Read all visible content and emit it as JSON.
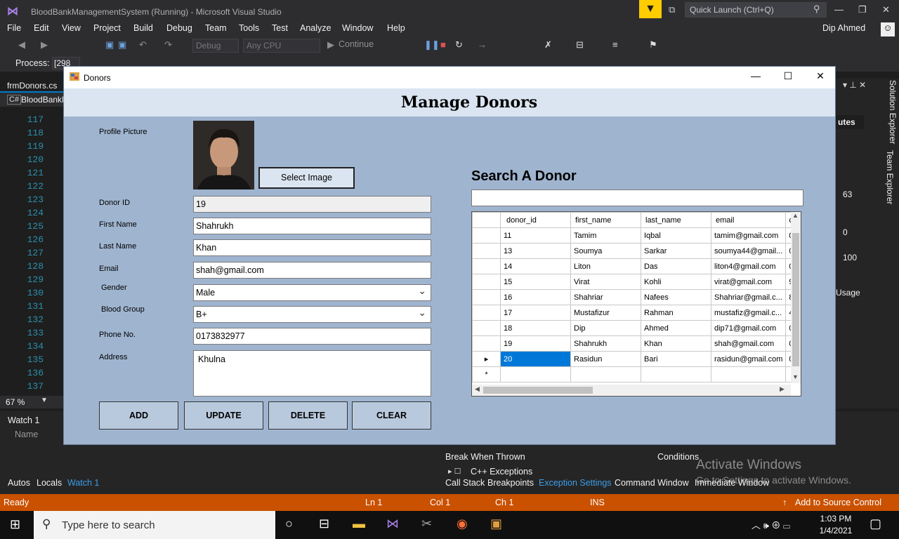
{
  "vs": {
    "title": "BloodBankManagementSystem (Running) - Microsoft Visual Studio",
    "quick_launch": "Quick Launch (Ctrl+Q)",
    "user": "Dip Ahmed",
    "menu": [
      "File",
      "Edit",
      "View",
      "Project",
      "Build",
      "Debug",
      "Team",
      "Tools",
      "Test",
      "Analyze",
      "Window",
      "Help"
    ],
    "toolbar": {
      "config": "Debug",
      "platform": "Any CPU",
      "continue": "Continue"
    },
    "process_label": "Process:",
    "process_value": "[298",
    "file_tab": "frmDonors.cs",
    "project_tab": "BloodBankM",
    "line_numbers": [
      "117",
      "118",
      "119",
      "120",
      "121",
      "122",
      "123",
      "124",
      "125",
      "126",
      "127",
      "128",
      "129",
      "130",
      "131",
      "132",
      "133",
      "134",
      "135",
      "136",
      "137"
    ],
    "zoom": "67 %",
    "right_panel": {
      "utes": "utes",
      "v63": "63",
      "v0": "0",
      "v100": "100",
      "usage": "Usage",
      "solution_explorer": "Solution Explorer",
      "team_explorer": "Team Explorer"
    },
    "watch": {
      "title": "Watch 1",
      "col_name": "Name"
    },
    "exceptions": {
      "col1": "Break When Thrown",
      "col2": "Conditions",
      "row": "C++ Exceptions"
    },
    "bottom_tabs_left": [
      "Autos",
      "Locals",
      "Watch 1"
    ],
    "bottom_tabs_right": [
      "Call Stack",
      "Breakpoints",
      "Exception Settings",
      "Command Window",
      "Immediate Window"
    ],
    "activate": {
      "line1": "Activate Windows",
      "line2": "Go to Settings to activate Windows."
    },
    "status": {
      "ready": "Ready",
      "ln": "Ln 1",
      "col": "Col 1",
      "ch": "Ch 1",
      "ins": "INS",
      "source_control": "Add to Source Control"
    }
  },
  "taskbar": {
    "search_placeholder": "Type here to search",
    "time": "1:03 PM",
    "date": "1/4/2021"
  },
  "donors": {
    "window_title": "Donors",
    "header": "Manage Donors",
    "labels": {
      "profile_picture": "Profile Picture",
      "donor_id": "Donor ID",
      "first_name": "First Name",
      "last_name": "Last Name",
      "email": "Email",
      "gender": "Gender",
      "blood_group": "Blood Group",
      "phone": "Phone No.",
      "address": "Address"
    },
    "values": {
      "donor_id": "19",
      "first_name": "Shahrukh",
      "last_name": "Khan",
      "email": "shah@gmail.com",
      "gender": "Male",
      "blood_group": "B+",
      "phone": "0173832977",
      "address": "Khulna"
    },
    "buttons": {
      "select_image": "Select Image",
      "add": "ADD",
      "update": "UPDATE",
      "delete": "DELETE",
      "clear": "CLEAR"
    },
    "search_title": "Search A Donor",
    "grid": {
      "columns": [
        "donor_id",
        "first_name",
        "last_name",
        "email",
        "c"
      ],
      "rows": [
        [
          "11",
          "Tamim",
          "Iqbal",
          "tamim@gmail.com",
          "0"
        ],
        [
          "13",
          "Soumya",
          "Sarkar",
          "soumya44@gmail...",
          "0"
        ],
        [
          "14",
          "Liton",
          "Das",
          "liton4@gmail.com",
          "0"
        ],
        [
          "15",
          "Virat",
          "Kohli",
          "virat@gmail.com",
          "9"
        ],
        [
          "16",
          "Shahriar",
          "Nafees",
          "Shahriar@gmail.c...",
          "8"
        ],
        [
          "17",
          "Mustafizur",
          "Rahman",
          "mustafiz@gmail.c...",
          "4"
        ],
        [
          "18",
          "Dip",
          "Ahmed",
          "dip71@gmail.com",
          "0"
        ],
        [
          "19",
          "Shahrukh",
          "Khan",
          "shah@gmail.com",
          "0"
        ],
        [
          "20",
          "Rasidun",
          "Bari",
          "rasidun@gmail.com",
          "0"
        ]
      ],
      "selected_row_index": 8,
      "new_row_marker": "*"
    }
  },
  "colors": {
    "status_bar": "#ca5100",
    "form_bg": "#9fb4cf",
    "header_bg": "#dbe5f1",
    "selection": "#0078d7"
  }
}
